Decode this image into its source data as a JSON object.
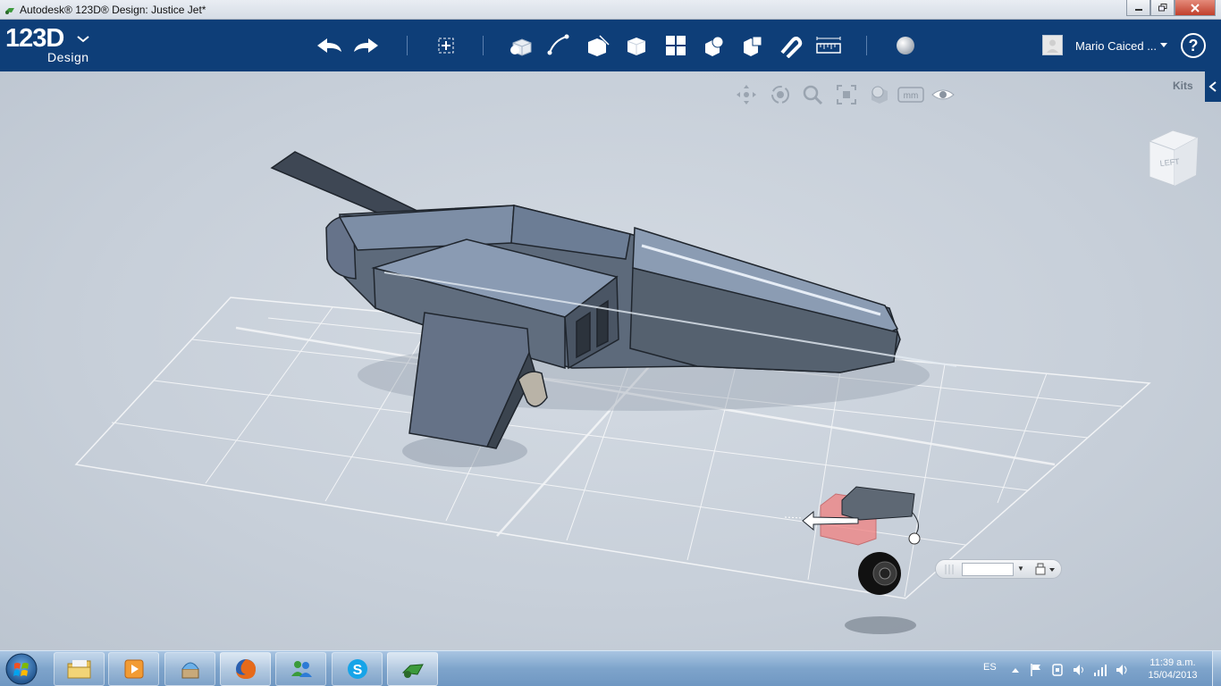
{
  "window": {
    "title": "Autodesk® 123D® Design: Justice Jet*",
    "controls": [
      "minimize",
      "maximize",
      "close"
    ]
  },
  "app": {
    "logo_main": "123D",
    "logo_sub": "Design"
  },
  "toolbar": {
    "tools": [
      "undo-icon",
      "redo-icon",
      "transform-icon",
      "primitives-icon",
      "sketch-icon",
      "construct-icon",
      "modify-icon",
      "pattern-icon",
      "group-icon",
      "combine-icon",
      "snap-icon",
      "measure-icon",
      "material-icon"
    ]
  },
  "user": {
    "name": "Mario Caiced ...",
    "help_label": "?"
  },
  "viewport": {
    "view_tools": [
      "pan-icon",
      "orbit-icon",
      "zoom-icon",
      "fit-icon",
      "visual-style-icon",
      "units-icon",
      "visibility-icon"
    ],
    "units_label": "mm",
    "kits_label": "Kits",
    "view_cube_face": "LEFT",
    "model_name": "Justice Jet",
    "mini_toolbar_value": ""
  },
  "taskbar": {
    "apps": [
      "windows-explorer",
      "media-player",
      "app-store",
      "firefox",
      "messenger",
      "skype",
      "123d-design"
    ],
    "language": "ES",
    "time": "11:39 a.m.",
    "date": "15/04/2013"
  }
}
